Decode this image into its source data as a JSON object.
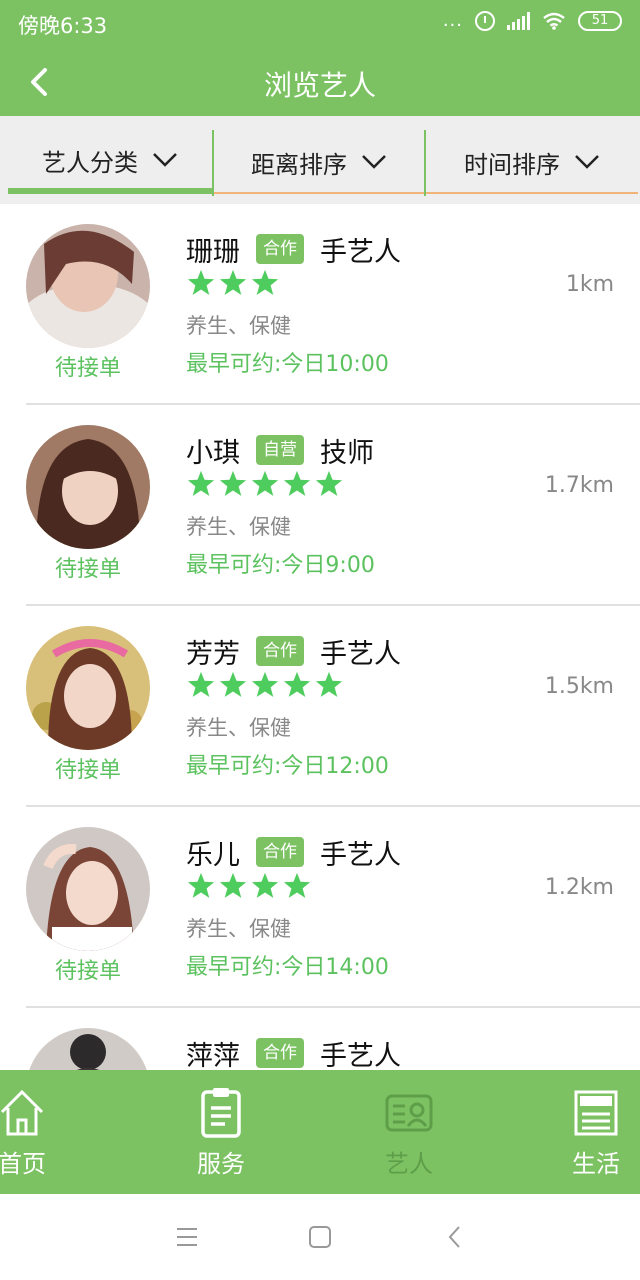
{
  "status_bar": {
    "time": "傍晚6:33",
    "battery": "51",
    "dots": "..."
  },
  "header": {
    "title": "浏览艺人"
  },
  "filters": [
    "艺人分类",
    "距离排序",
    "时间排序"
  ],
  "artists": [
    {
      "name": "珊珊",
      "tag": "合作",
      "role": "手艺人",
      "stars": 3,
      "service": "养生、保健",
      "earliest": "最早可约:今日10:00",
      "distance": "1km",
      "status": "待接单"
    },
    {
      "name": "小琪",
      "tag": "自营",
      "role": "技师",
      "stars": 5,
      "service": "养生、保健",
      "earliest": "最早可约:今日9:00",
      "distance": "1.7km",
      "status": "待接单"
    },
    {
      "name": "芳芳",
      "tag": "合作",
      "role": "手艺人",
      "stars": 5,
      "service": "养生、保健",
      "earliest": "最早可约:今日12:00",
      "distance": "1.5km",
      "status": "待接单"
    },
    {
      "name": "乐儿",
      "tag": "合作",
      "role": "手艺人",
      "stars": 4,
      "service": "养生、保健",
      "earliest": "最早可约:今日14:00",
      "distance": "1.2km",
      "status": "待接单"
    },
    {
      "name": "萍萍",
      "tag": "合作",
      "role": "手艺人",
      "stars": 0,
      "service": "",
      "earliest": "",
      "distance": "",
      "status": ""
    }
  ],
  "bottom_nav": [
    {
      "label": "首页",
      "icon": "home-icon"
    },
    {
      "label": "服务",
      "icon": "clipboard-icon"
    },
    {
      "label": "艺人",
      "icon": "id-card-icon",
      "active": true
    },
    {
      "label": "生活",
      "icon": "news-icon"
    }
  ],
  "colors": {
    "brand": "#7cc263",
    "accent_green": "#5cc25f",
    "filter_underline": "#f2b37a"
  }
}
